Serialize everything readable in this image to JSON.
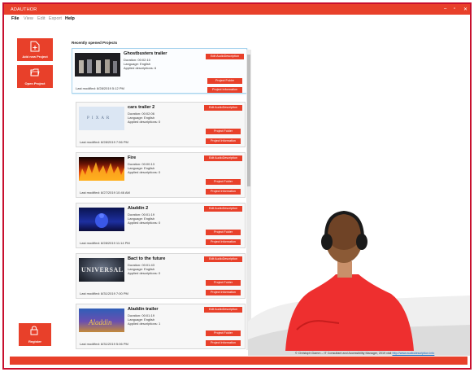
{
  "app": {
    "title": "ADAUTHOR",
    "controls": [
      "–",
      "▫",
      "✕"
    ]
  },
  "menu": [
    "File",
    "View",
    "Edit",
    "Export",
    "Help"
  ],
  "sidebar": {
    "add_project": "Add new Project",
    "open_project": "Open Project",
    "register": "Register"
  },
  "section_title": "Recently opened Projects",
  "buttons": {
    "edit": "Edit AudioDescription",
    "folder": "Project Folder",
    "info": "Project Information"
  },
  "projects": [
    {
      "title": "Ghostbusters trailer",
      "duration": "Duration: 00:02:10",
      "language": "Language: English",
      "descriptions": "Applied descriptions: 6",
      "modified": "Last modified: 8/28/2019 5:12 PM",
      "thumb": "ghostbusters"
    },
    {
      "title": "cars trailer 2",
      "duration": "Duration: 00:02:06",
      "language": "Language: English",
      "descriptions": "Applied descriptions: 0",
      "modified": "Last modified: 8/28/2019 7:56 PM",
      "thumb": "pixar",
      "thumb_text": "P I X A R"
    },
    {
      "title": "Fire",
      "duration": "Duration: 00:00:13",
      "language": "Language: English",
      "descriptions": "Applied descriptions: 0",
      "modified": "Last modified: 8/27/2019 10:46 AM",
      "thumb": "fire"
    },
    {
      "title": "Aladdin 2",
      "duration": "Duration: 00:01:19",
      "language": "Language: English",
      "descriptions": "Applied descriptions: 0",
      "modified": "Last modified: 8/28/2019 11:14 PM",
      "thumb": "aladdin2"
    },
    {
      "title": "Bact to the future",
      "duration": "Duration: 00:01:43",
      "language": "Language: English",
      "descriptions": "Applied descriptions: 0",
      "modified": "Last modified: 8/31/2019 7:00 PM",
      "thumb": "universal",
      "thumb_text": "UNIVERSAL"
    },
    {
      "title": "Aladdin trailer",
      "duration": "Duration: 00:01:19",
      "language": "Language: English",
      "descriptions": "Applied descriptions: 1",
      "modified": "Last modified: 8/31/2019 5:06 PM",
      "thumb": "aladdin",
      "thumb_text": "Aladdin"
    }
  ],
  "footer": {
    "text": "© Christoph Damm – IT Consultant and Accessibility Manager, 2019 visit",
    "link": "http://www.audiodescription.info"
  },
  "colors": {
    "accent": "#e8402a",
    "frame": "#c8102e"
  }
}
